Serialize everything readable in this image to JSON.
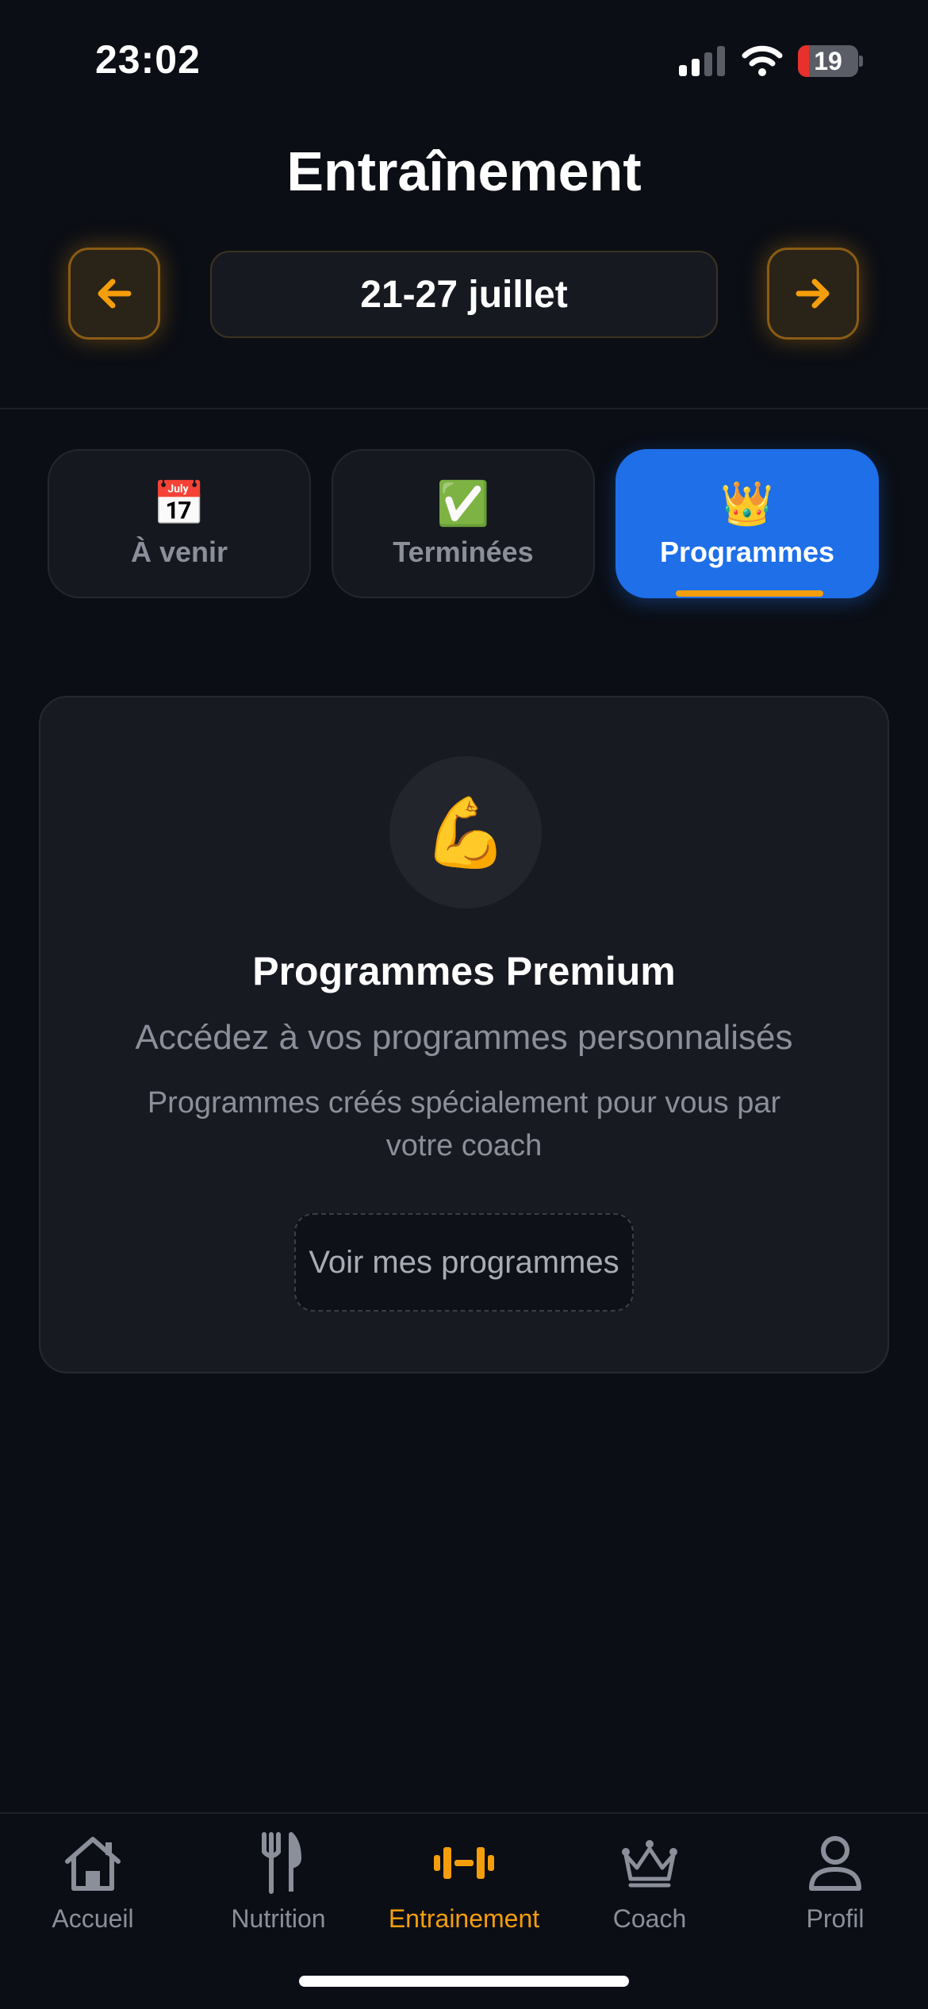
{
  "status_bar": {
    "time": "23:02",
    "battery_level": "19",
    "battery_fraction": 0.19,
    "signal_bars_active": 2
  },
  "header": {
    "title": "Entraînement",
    "week_range": "21-27 juillet",
    "prev_icon": "arrow-left-icon",
    "next_icon": "arrow-right-icon"
  },
  "tabs": [
    {
      "emoji": "📅",
      "label": "À venir",
      "active": false
    },
    {
      "emoji": "✅",
      "label": "Terminées",
      "active": false
    },
    {
      "emoji": "👑",
      "label": "Programmes",
      "active": true
    }
  ],
  "card": {
    "emoji": "💪",
    "title": "Programmes Premium",
    "subtitle": "Accédez à vos programmes personnalisés",
    "description": "Programmes créés spécialement pour vous par votre coach",
    "button_label": "Voir mes programmes"
  },
  "bottom_nav": [
    {
      "label": "Accueil",
      "icon": "home-icon",
      "active": false
    },
    {
      "label": "Nutrition",
      "icon": "fork-knife-icon",
      "active": false
    },
    {
      "label": "Entrainement",
      "icon": "dumbbell-icon",
      "active": true
    },
    {
      "label": "Coach",
      "icon": "crown-icon",
      "active": false
    },
    {
      "label": "Profil",
      "icon": "user-icon",
      "active": false
    }
  ],
  "colors": {
    "background": "#0b0e15",
    "accent": "#f59e0b",
    "active_tab": "#1e6fe8",
    "muted_text": "#8b8f99",
    "battery_low": "#e8302c"
  }
}
